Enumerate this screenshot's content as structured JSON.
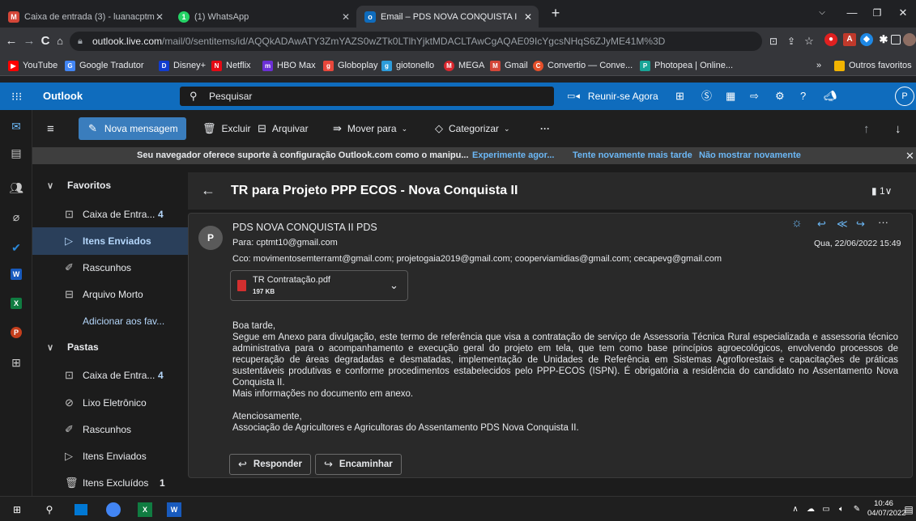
{
  "browser": {
    "tabs": [
      {
        "title": "Caixa de entrada (3) - luanacptm",
        "favicon_letter": "M",
        "favicon_color": "#d44638",
        "active": false
      },
      {
        "title": "(1) WhatsApp",
        "favicon_letter": "1",
        "favicon_color": "#25d366",
        "active": false
      },
      {
        "title": "Email – PDS NOVA CONQUISTA I",
        "favicon_letter": "o",
        "favicon_color": "#0f6cbd",
        "active": true
      }
    ],
    "url_host": "outlook.live.com",
    "url_path": "/mail/0/sentitems/id/AQQkADAwATY3ZmYAZS0wZTk0LTlhYjktMDACLTAwCgAQAE09IcYgcsNHqS6ZJyME41M%3D",
    "bookmarks": [
      {
        "label": "YouTube",
        "color": "#ff0000",
        "glyph": "▶"
      },
      {
        "label": "Google Tradutor",
        "color": "#4285f4",
        "glyph": "G"
      },
      {
        "label": "Disney+",
        "color": "#113ccf",
        "glyph": "D"
      },
      {
        "label": "Netflix",
        "color": "#e50914",
        "glyph": "N"
      },
      {
        "label": "HBO Max",
        "color": "#6b2fd6",
        "glyph": "m"
      },
      {
        "label": "Globoplay",
        "color": "#e8473b",
        "glyph": "g"
      },
      {
        "label": "giotonello",
        "color": "#2d9cdb",
        "glyph": "g"
      },
      {
        "label": "MEGA",
        "color": "#d9272e",
        "glyph": "M"
      },
      {
        "label": "Gmail",
        "color": "#d44638",
        "glyph": "M"
      },
      {
        "label": "Convertio — Conve...",
        "color": "#e54f2a",
        "glyph": "C"
      },
      {
        "label": "Photopea | Online...",
        "color": "#18a497",
        "glyph": "P"
      }
    ],
    "bookmarks_more": "»",
    "other_favorites": "Outros favoritos"
  },
  "outlook": {
    "brand": "Outlook",
    "search_placeholder": "Pesquisar",
    "meet_now": "Reunir-se Agora",
    "profile_initial": "P",
    "command_bar": {
      "new_message": "Nova mensagem",
      "delete": "Excluir",
      "archive": "Arquivar",
      "move_to": "Mover para",
      "categorize": "Categorizar",
      "more": "···"
    },
    "banner": {
      "message": "Seu navegador oferece suporte à configuração Outlook.com como o manipu...",
      "try_now": "Experimente agor...",
      "try_later": "Tente novamente mais tarde",
      "dont_show": "Não mostrar novamente"
    },
    "folders": {
      "favorites_header": "Favoritos",
      "favorites": [
        {
          "label": "Caixa de Entra...",
          "count": "4",
          "icon": "inbox-icon"
        },
        {
          "label": "Itens Enviados",
          "count": "",
          "icon": "sent-icon"
        },
        {
          "label": "Rascunhos",
          "count": "",
          "icon": "drafts-icon"
        },
        {
          "label": "Arquivo Morto",
          "count": "",
          "icon": "archive-icon"
        }
      ],
      "add_favorite": "Adicionar aos fav...",
      "folders_header": "Pastas",
      "folders": [
        {
          "label": "Caixa de Entra...",
          "count": "4",
          "icon": "inbox-icon"
        },
        {
          "label": "Lixo Eletrônico",
          "count": "",
          "icon": "junk-icon"
        },
        {
          "label": "Rascunhos",
          "count": "",
          "icon": "drafts-icon"
        },
        {
          "label": "Itens Enviados",
          "count": "",
          "icon": "sent-icon"
        },
        {
          "label": "Itens Excluídos",
          "count": "1",
          "icon": "trash-icon"
        }
      ]
    },
    "message": {
      "subject": "TR para Projeto PPP ECOS - Nova Conquista II",
      "attachment_count": "1",
      "avatar_initial": "P",
      "sender": "PDS NOVA CONQUISTA II PDS",
      "to": "Para: cptmt10@gmail.com",
      "bcc": "Cco: movimentosemterramt@gmail.com;  projetogaia2019@gmail.com;  cooperviamidias@gmail.com;  cecapevg@gmail.com",
      "date": "Qua, 22/06/2022 15:49",
      "attachment": {
        "name": "TR Contratação.pdf",
        "size": "197 KB"
      },
      "greeting": "Boa tarde,",
      "body": "Segue em Anexo para divulgação, este termo de referência que visa a contratação de serviço de Assessoria Técnica Rural especializada e assessoria técnico administrativa para o acompanhamento e execução  geral do projeto em tela, que tem como base princípios agroecológicos, envolvendo processos de recuperação de áreas degradadas e desmatadas, implementação de Unidades de Referência em Sistemas Agroflorestais e capacitações de práticas sustentáveis produtivas e conforme procedimentos estabelecidos pelo PPP-ECOS (ISPN). É obrigatória a residência do candidato no Assentamento Nova Conquista II.",
      "more_info": "Mais informações no documento em anexo.",
      "signoff": "Atenciosamente,",
      "signature": "Associação de Agricultores e Agricultoras do Assentamento PDS Nova Conquista II.",
      "reply": "Responder",
      "forward": "Encaminhar"
    }
  },
  "taskbar": {
    "time": "10:46",
    "date": "04/07/2022"
  }
}
